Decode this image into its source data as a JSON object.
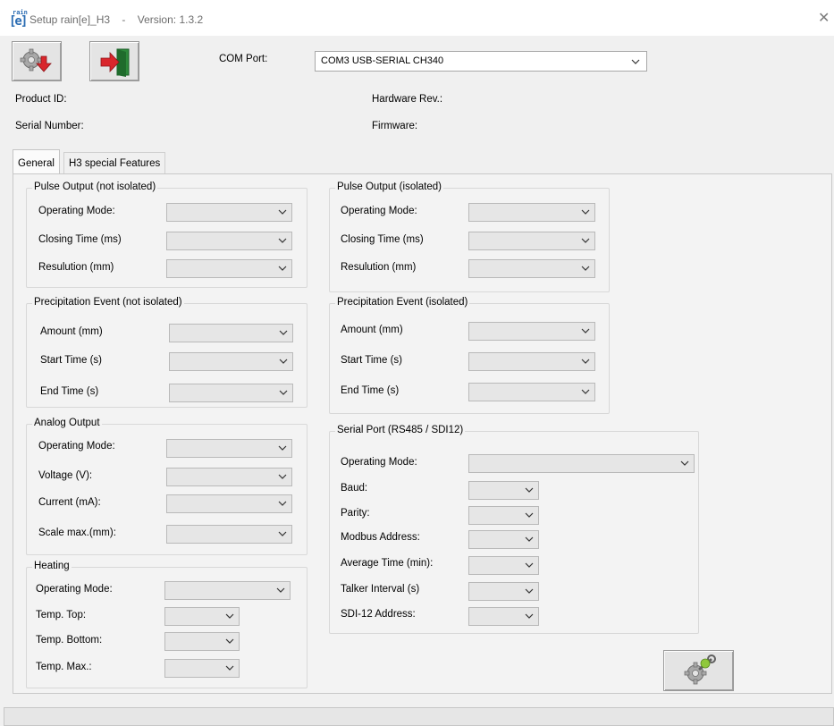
{
  "window": {
    "title": "Setup rain[e]_H3",
    "separator": "-",
    "version": "Version: 1.3.2",
    "icon_top": "rain",
    "icon_main": "[e]",
    "close_glyph": "✕"
  },
  "toolbar": {
    "read_icon": "gear-download-icon",
    "exit_icon": "exit-door-icon",
    "com_port_label": "COM Port:",
    "com_port_value": "COM3  USB-SERIAL CH340"
  },
  "info": {
    "product_id_label": "Product ID:",
    "serial_number_label": "Serial Number:",
    "hardware_rev_label": "Hardware Rev.:",
    "firmware_label": "Firmware:"
  },
  "tabs": [
    "General",
    "H3 special Features"
  ],
  "pulse_not_isolated": {
    "title": "Pulse Output (not isolated)",
    "operating_mode": "Operating Mode:",
    "closing_time": "Closing Time (ms)",
    "resolution": "Resulution (mm)"
  },
  "pulse_isolated": {
    "title": "Pulse Output (isolated)",
    "operating_mode": "Operating Mode:",
    "closing_time": "Closing Time (ms)",
    "resolution": "Resulution (mm)"
  },
  "precip_not_isolated": {
    "title": "Precipitation Event (not isolated)",
    "amount": "Amount (mm)",
    "start_time": "Start Time (s)",
    "end_time": "End Time (s)"
  },
  "precip_isolated": {
    "title": "Precipitation Event (isolated)",
    "amount": "Amount (mm)",
    "start_time": "Start Time (s)",
    "end_time": "End Time (s)"
  },
  "analog": {
    "title": "Analog Output",
    "operating_mode": "Operating Mode:",
    "voltage": "Voltage (V):",
    "current": "Current (mA):",
    "scale_max": "Scale max.(mm):"
  },
  "heating": {
    "title": "Heating",
    "operating_mode": "Operating Mode:",
    "temp_top": "Temp. Top:",
    "temp_bottom": "Temp. Bottom:",
    "temp_max": "Temp. Max.:"
  },
  "serial": {
    "title": "Serial Port (RS485 / SDI12)",
    "operating_mode": "Operating Mode:",
    "baud": "Baud:",
    "parity": "Parity:",
    "modbus_address": "Modbus Address:",
    "average_time": "Average Time (min):",
    "talker_interval": "Talker Interval (s)",
    "sdi12_address": "SDI-12 Address:"
  },
  "actions": {
    "write_icon": "gear-wrench-icon"
  },
  "colors": {
    "accent_blue": "#2c6db3",
    "exit_red": "#d9262c",
    "door_green": "#2d8a3b"
  }
}
